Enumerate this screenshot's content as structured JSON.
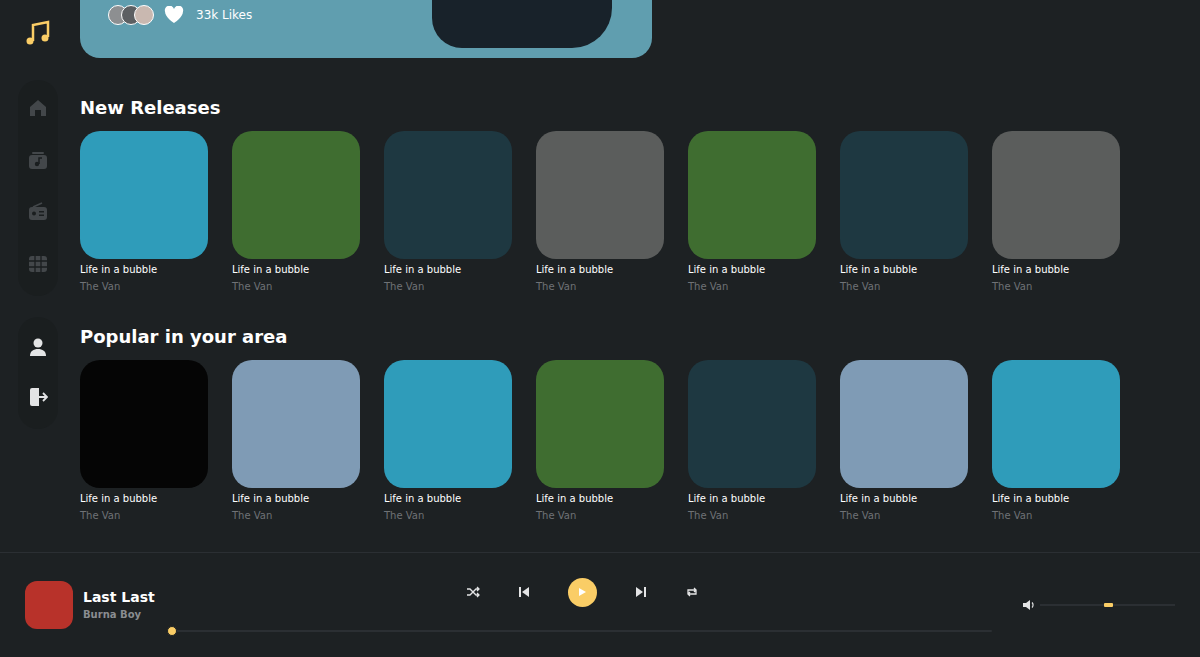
{
  "hero": {
    "likes": "33k Likes",
    "avatars": [
      {
        "color": "#8d8f91"
      },
      {
        "color": "#5c5f62"
      },
      {
        "color": "#c9b8b0"
      }
    ]
  },
  "sidebar": {
    "nav": [
      {
        "kind": "home",
        "selected": false
      },
      {
        "kind": "library",
        "selected": false
      },
      {
        "kind": "radio",
        "selected": false
      },
      {
        "kind": "videos",
        "selected": false
      }
    ],
    "account": [
      {
        "kind": "profile",
        "selected": false
      },
      {
        "kind": "logout",
        "selected": false
      }
    ]
  },
  "sections": [
    {
      "title": "New Releases",
      "cards": [
        {
          "title": "Life in a bubble",
          "artist": "The Van",
          "color": "#2f9cba"
        },
        {
          "title": "Life in a bubble",
          "artist": "The Van",
          "color": "#3f6d30"
        },
        {
          "title": "Life in a bubble",
          "artist": "The Van",
          "color": "#1e3841"
        },
        {
          "title": "Life in a bubble",
          "artist": "The Van",
          "color": "#5b5d5c"
        },
        {
          "title": "Life in a bubble",
          "artist": "The Van",
          "color": "#3f6d30"
        },
        {
          "title": "Life in a bubble",
          "artist": "The Van",
          "color": "#1e3841"
        },
        {
          "title": "Life in a bubble",
          "artist": "The Van",
          "color": "#5b5d5c"
        }
      ]
    },
    {
      "title": "Popular in your area",
      "cards": [
        {
          "title": "Life in a bubble",
          "artist": "The Van",
          "color": "#050505"
        },
        {
          "title": "Life in a bubble",
          "artist": "The Van",
          "color": "#7f9bb5"
        },
        {
          "title": "Life in a bubble",
          "artist": "The Van",
          "color": "#2f9cba"
        },
        {
          "title": "Life in a bubble",
          "artist": "The Van",
          "color": "#3f6d30"
        },
        {
          "title": "Life in a bubble",
          "artist": "The Van",
          "color": "#1e3841"
        },
        {
          "title": "Life in a bubble",
          "artist": "The Van",
          "color": "#7f9bb5"
        },
        {
          "title": "Life in a bubble",
          "artist": "The Van",
          "color": "#2f9cba"
        }
      ]
    }
  ],
  "player": {
    "track": "Last Last",
    "artist": "Burna Boy",
    "cover_color": "#b8322a",
    "playing": false,
    "shuffle": false,
    "repeat": false,
    "progress": 0,
    "volume": 0.5
  }
}
